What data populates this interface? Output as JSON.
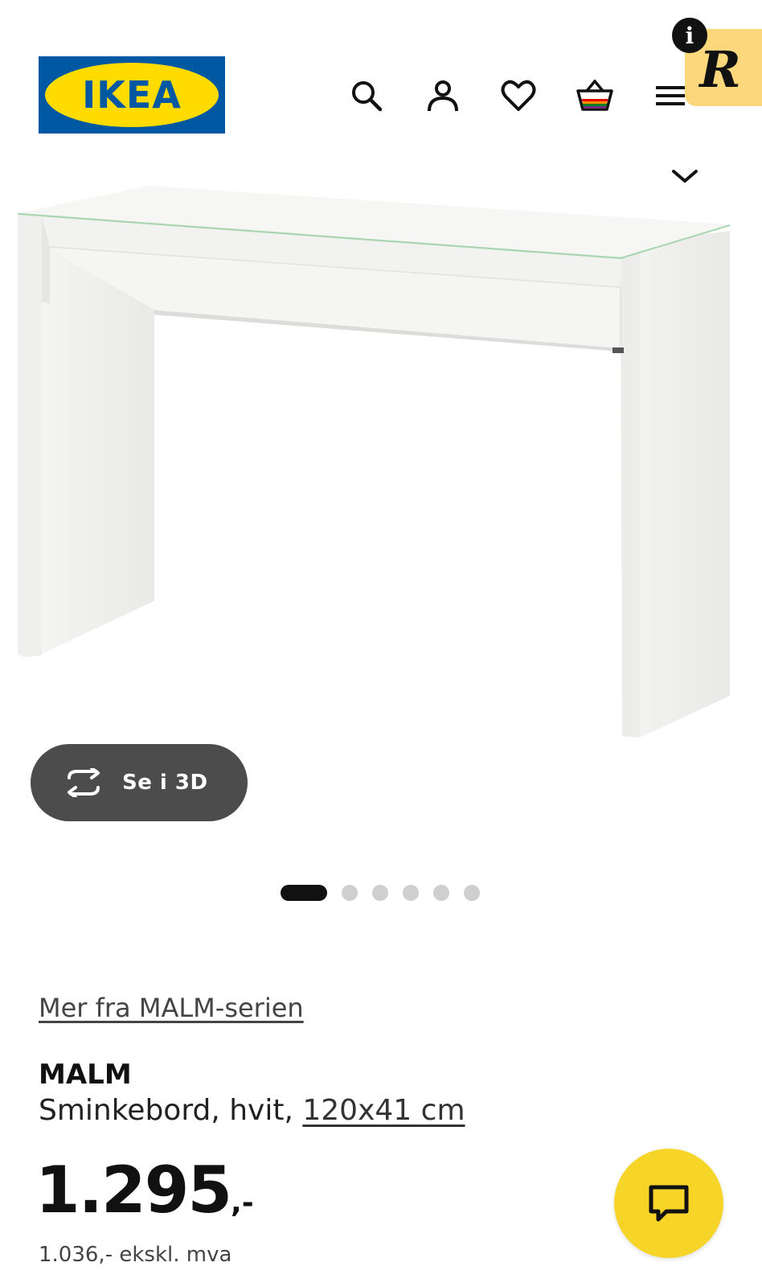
{
  "brand": {
    "logo_text": "IKEA",
    "logo_colors": {
      "blue": "#0058a3",
      "yellow": "#ffdb00"
    }
  },
  "header": {
    "icons": [
      "search-icon",
      "account-icon",
      "heart-icon",
      "basket-icon",
      "menu-icon"
    ]
  },
  "extension": {
    "badge": "i",
    "logo_letter": "R"
  },
  "gallery": {
    "view_3d_label": "Se i 3D",
    "slide_count": 6,
    "active_slide": 1
  },
  "product": {
    "series_link": "Mer fra MALM-serien",
    "name": "MALM",
    "description": "Sminkebord, hvit,",
    "dimensions": "120x41 cm",
    "price_main": "1.295",
    "price_suffix": ",-",
    "price_ex_vat": "1.036,- ekskl. mva"
  },
  "colors": {
    "accent": "#f7d528",
    "text": "#111111",
    "button_dark": "#4c4c4c"
  }
}
